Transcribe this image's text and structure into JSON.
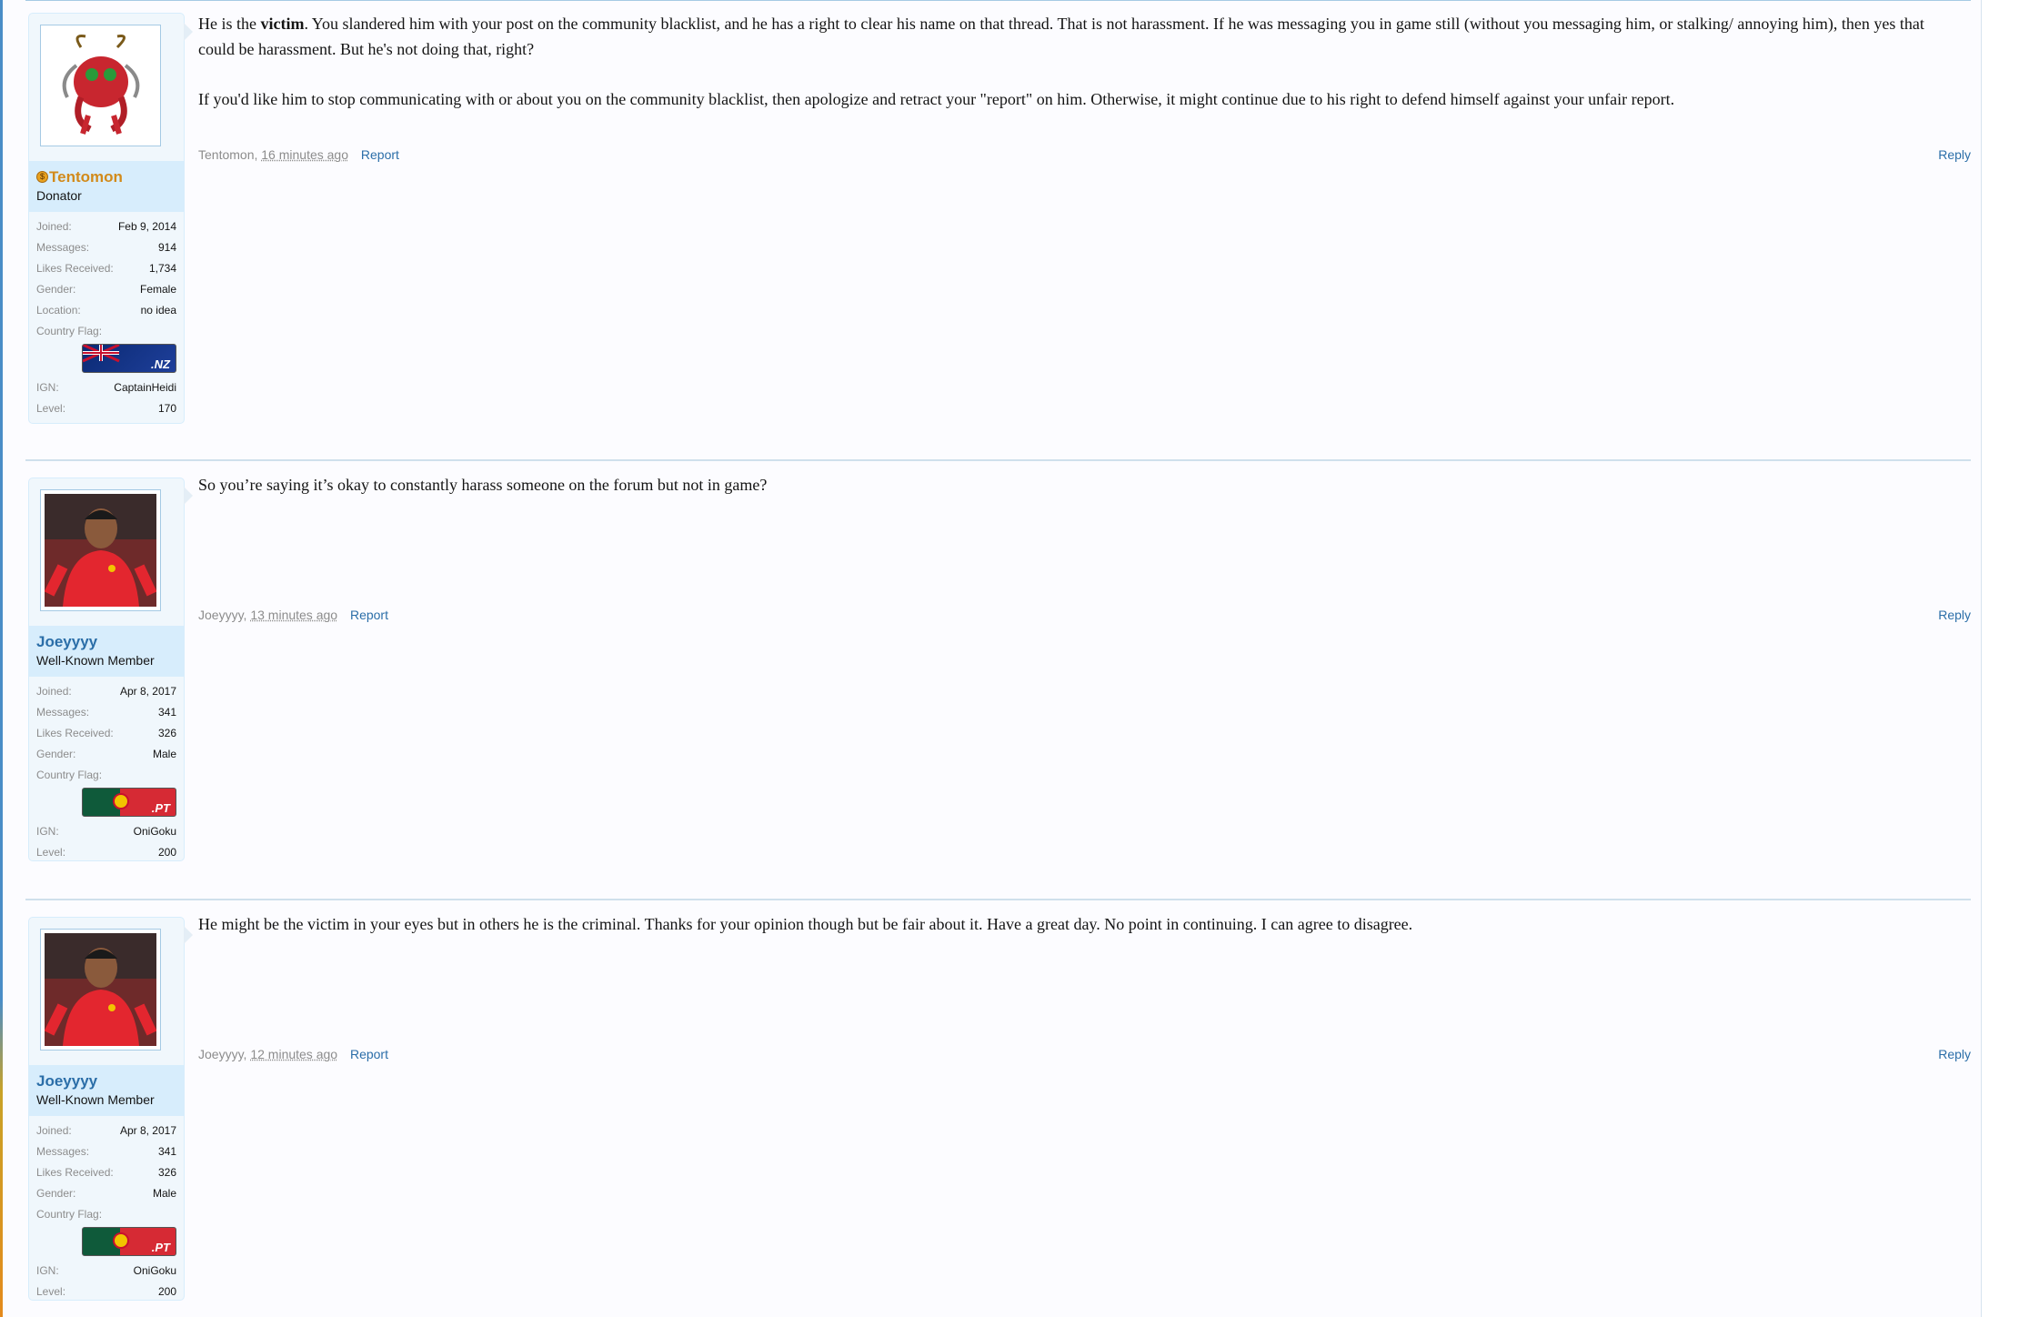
{
  "posts": [
    {
      "username": "Tentomon",
      "usertitle": "Donator",
      "donator": true,
      "avatar_icon": "tentomon-avatar",
      "paragraphs": [
        "He is the victim. You slandered him with your post on the community blacklist, and he has a right to clear his name on that thread. That is not harassment. If he was messaging you in game still (without you messaging him, or stalking/ annoying him), then yes that could be harassment. But he's not doing that, right?",
        "If you'd like him to stop communicating with or about you on the community blacklist, then apologize and retract your \"report\" on him. Otherwise, it might continue due to his right to defend himself against your unfair report."
      ],
      "bold_word": "victim",
      "meta": {
        "author": "Tentomon",
        "time": "16 minutes ago",
        "report": "Report",
        "reply": "Reply"
      },
      "stats": [
        {
          "label": "Joined:",
          "value": "Feb 9, 2014"
        },
        {
          "label": "Messages:",
          "value": "914"
        },
        {
          "label": "Likes Received:",
          "value": "1,734"
        },
        {
          "label": "Gender:",
          "value": "Female"
        },
        {
          "label": "Location:",
          "value": "no idea"
        }
      ],
      "flag_label": "Country Flag:",
      "flag_code": ".NZ",
      "flag_colors": [
        "#0b2a74",
        "#1e3f9a"
      ],
      "ign": {
        "label": "IGN:",
        "value": "CaptainHeidi"
      },
      "level": {
        "label": "Level:",
        "value": "170"
      }
    },
    {
      "username": "Joeyyyy",
      "usertitle": "Well-Known Member",
      "donator": false,
      "avatar_icon": "player-avatar",
      "paragraphs": [
        "So you’re saying it’s okay to constantly harass someone on the forum but not in game?"
      ],
      "meta": {
        "author": "Joeyyyy",
        "time": "13 minutes ago",
        "report": "Report",
        "reply": "Reply"
      },
      "stats": [
        {
          "label": "Joined:",
          "value": "Apr 8, 2017"
        },
        {
          "label": "Messages:",
          "value": "341"
        },
        {
          "label": "Likes Received:",
          "value": "326"
        },
        {
          "label": "Gender:",
          "value": "Male"
        }
      ],
      "flag_label": "Country Flag:",
      "flag_code": ".PT",
      "flag_colors": [
        "#0f5a3a",
        "#d62a34"
      ],
      "ign": {
        "label": "IGN:",
        "value": "OniGoku"
      },
      "level": {
        "label": "Level:",
        "value": "200"
      }
    },
    {
      "username": "Joeyyyy",
      "usertitle": "Well-Known Member",
      "donator": false,
      "avatar_icon": "player-avatar",
      "paragraphs": [
        "He might be the victim in your eyes but in others he is the criminal. Thanks for your opinion though but be fair about it. Have a great day. No point in continuing. I can agree to disagree."
      ],
      "meta": {
        "author": "Joeyyyy",
        "time": "12 minutes ago",
        "report": "Report",
        "reply": "Reply"
      },
      "stats": [
        {
          "label": "Joined:",
          "value": "Apr 8, 2017"
        },
        {
          "label": "Messages:",
          "value": "341"
        },
        {
          "label": "Likes Received:",
          "value": "326"
        },
        {
          "label": "Gender:",
          "value": "Male"
        }
      ],
      "flag_label": "Country Flag:",
      "flag_code": ".PT",
      "flag_colors": [
        "#0f5a3a",
        "#d62a34"
      ],
      "ign": {
        "label": "IGN:",
        "value": "OniGoku"
      },
      "level": {
        "label": "Level:",
        "value": "200"
      }
    }
  ]
}
